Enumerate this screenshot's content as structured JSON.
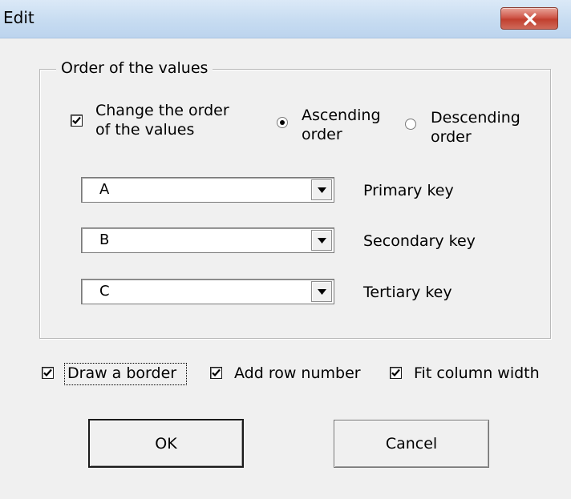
{
  "window": {
    "title": "Edit",
    "close_icon": "close-icon"
  },
  "order_group": {
    "legend": "Order of the values",
    "change_order": {
      "label_line1": "Change the order",
      "label_line2": "of the values",
      "checked": true
    },
    "ascending": {
      "label_line1": "Ascending",
      "label_line2": "order",
      "selected": true
    },
    "descending": {
      "label_line1": "Descending",
      "label_line2": "order",
      "selected": false
    },
    "keys": [
      {
        "value": "A",
        "label": "Primary key"
      },
      {
        "value": "B",
        "label": "Secondary key"
      },
      {
        "value": "C",
        "label": "Tertiary key"
      }
    ]
  },
  "options": {
    "draw_border": {
      "label": "Draw a border",
      "checked": true
    },
    "add_row_number": {
      "label": "Add row number",
      "checked": true
    },
    "fit_column_width": {
      "label": "Fit column width",
      "checked": true
    }
  },
  "buttons": {
    "ok": "OK",
    "cancel": "Cancel"
  }
}
